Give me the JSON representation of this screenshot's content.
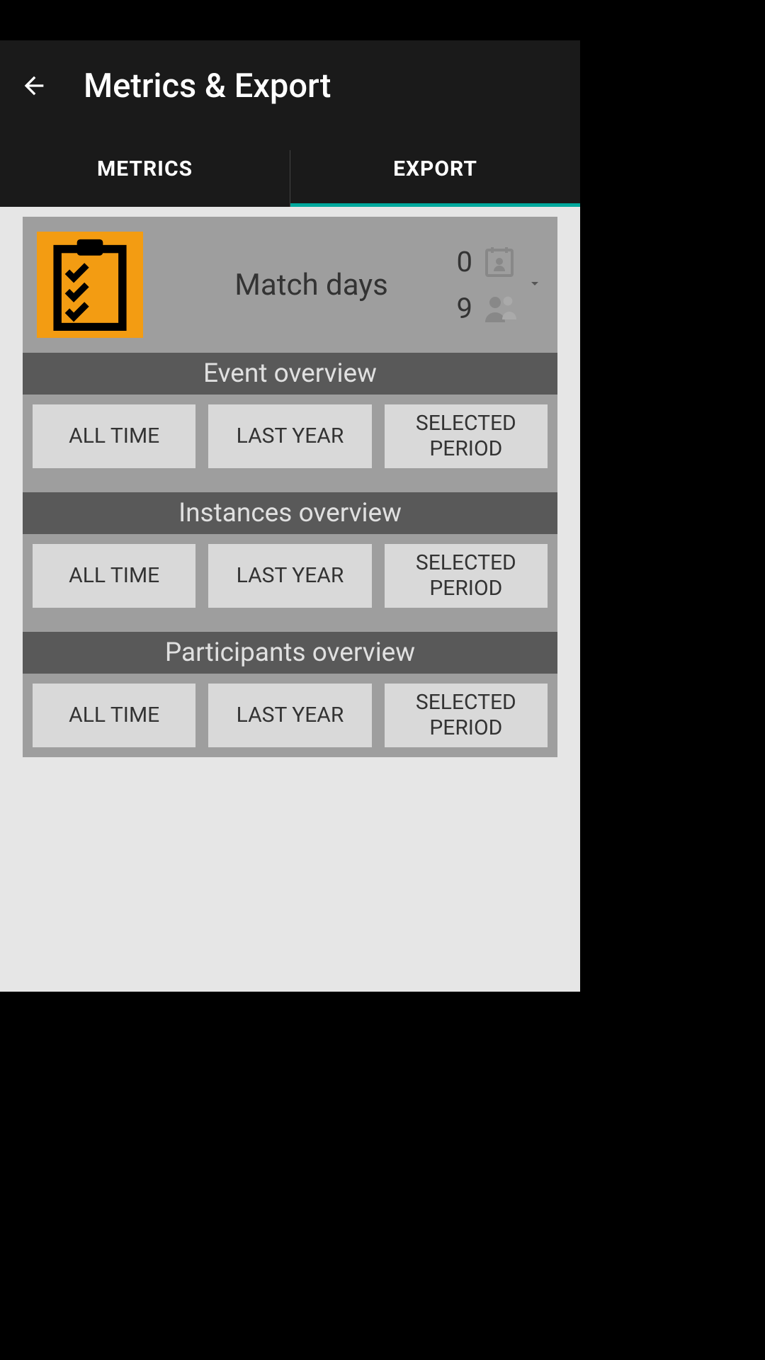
{
  "header": {
    "title": "Metrics & Export"
  },
  "tabs": {
    "metrics": "METRICS",
    "export": "EXPORT"
  },
  "event": {
    "name": "Match days",
    "calendar_count": "0",
    "people_count": "9"
  },
  "sections": [
    {
      "title": "Event overview",
      "buttons": [
        "ALL TIME",
        "LAST YEAR",
        "SELECTED PERIOD"
      ]
    },
    {
      "title": "Instances overview",
      "buttons": [
        "ALL TIME",
        "LAST YEAR",
        "SELECTED PERIOD"
      ]
    },
    {
      "title": "Participants overview",
      "buttons": [
        "ALL TIME",
        "LAST YEAR",
        "SELECTED PERIOD"
      ]
    }
  ]
}
